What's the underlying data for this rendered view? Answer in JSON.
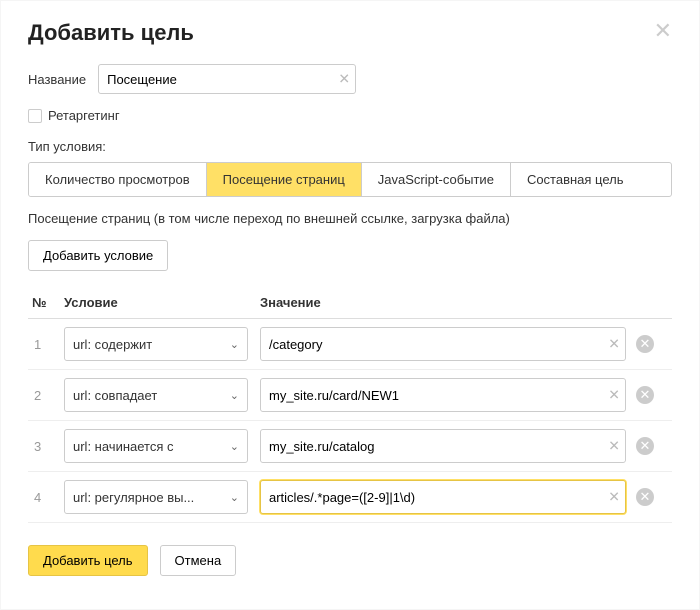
{
  "title": "Добавить цель",
  "name_label": "Название",
  "name_value": "Посещение",
  "retargeting_label": "Ретаргетинг",
  "retargeting_checked": false,
  "condition_type_label": "Тип условия:",
  "tabs": [
    {
      "label": "Количество просмотров",
      "active": false
    },
    {
      "label": "Посещение страниц",
      "active": true
    },
    {
      "label": "JavaScript-событие",
      "active": false
    },
    {
      "label": "Составная цель",
      "active": false
    }
  ],
  "description": "Посещение страниц (в том числе переход по внешней ссылке, загрузка файла)",
  "add_condition_label": "Добавить условие",
  "columns": {
    "num": "№",
    "condition": "Условие",
    "value": "Значение"
  },
  "rows": [
    {
      "num": "1",
      "condition": "url: содержит",
      "value": "/category",
      "highlight": false
    },
    {
      "num": "2",
      "condition": "url: совпадает",
      "value": "my_site.ru/card/NEW1",
      "highlight": false
    },
    {
      "num": "3",
      "condition": "url: начинается с",
      "value": "my_site.ru/catalog",
      "highlight": false
    },
    {
      "num": "4",
      "condition": "url: регулярное вы...",
      "value": "articles/.*page=([2-9]|1\\d)",
      "highlight": true
    }
  ],
  "submit_label": "Добавить цель",
  "cancel_label": "Отмена"
}
